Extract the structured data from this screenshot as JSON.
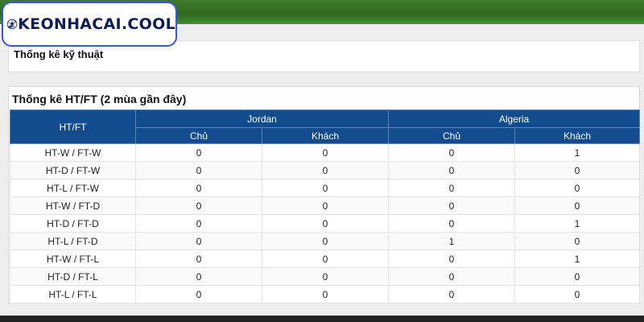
{
  "logo": {
    "text": "KEONHACAI.COOL"
  },
  "tech_panel": {
    "title": "Thống kê kỹ thuật"
  },
  "htft_panel": {
    "title": "Thống kê HT/FT (2 mùa gần đây)",
    "col_header": "HT/FT",
    "teams": [
      "Jordan",
      "Algeria"
    ],
    "sub_headers": [
      "Chủ",
      "Khách",
      "Chủ",
      "Khách"
    ],
    "rows": [
      {
        "label": "HT-W / FT-W",
        "values": [
          "0",
          "0",
          "0",
          "1"
        ]
      },
      {
        "label": "HT-D / FT-W",
        "values": [
          "0",
          "0",
          "0",
          "0"
        ]
      },
      {
        "label": "HT-L / FT-W",
        "values": [
          "0",
          "0",
          "0",
          "0"
        ]
      },
      {
        "label": "HT-W / FT-D",
        "values": [
          "0",
          "0",
          "0",
          "0"
        ]
      },
      {
        "label": "HT-D / FT-D",
        "values": [
          "0",
          "0",
          "0",
          "1"
        ]
      },
      {
        "label": "HT-L / FT-D",
        "values": [
          "0",
          "0",
          "1",
          "0"
        ]
      },
      {
        "label": "HT-W / FT-L",
        "values": [
          "0",
          "0",
          "0",
          "1"
        ]
      },
      {
        "label": "HT-D / FT-L",
        "values": [
          "0",
          "0",
          "0",
          "0"
        ]
      },
      {
        "label": "HT-L / FT-L",
        "values": [
          "0",
          "0",
          "0",
          "0"
        ]
      }
    ]
  },
  "colors": {
    "header_blue": "#124c8f",
    "logo_border": "#3a55e0",
    "logo_text": "#0f1e5a"
  },
  "icons": {
    "logo": "soccer-player-ball-icon"
  }
}
